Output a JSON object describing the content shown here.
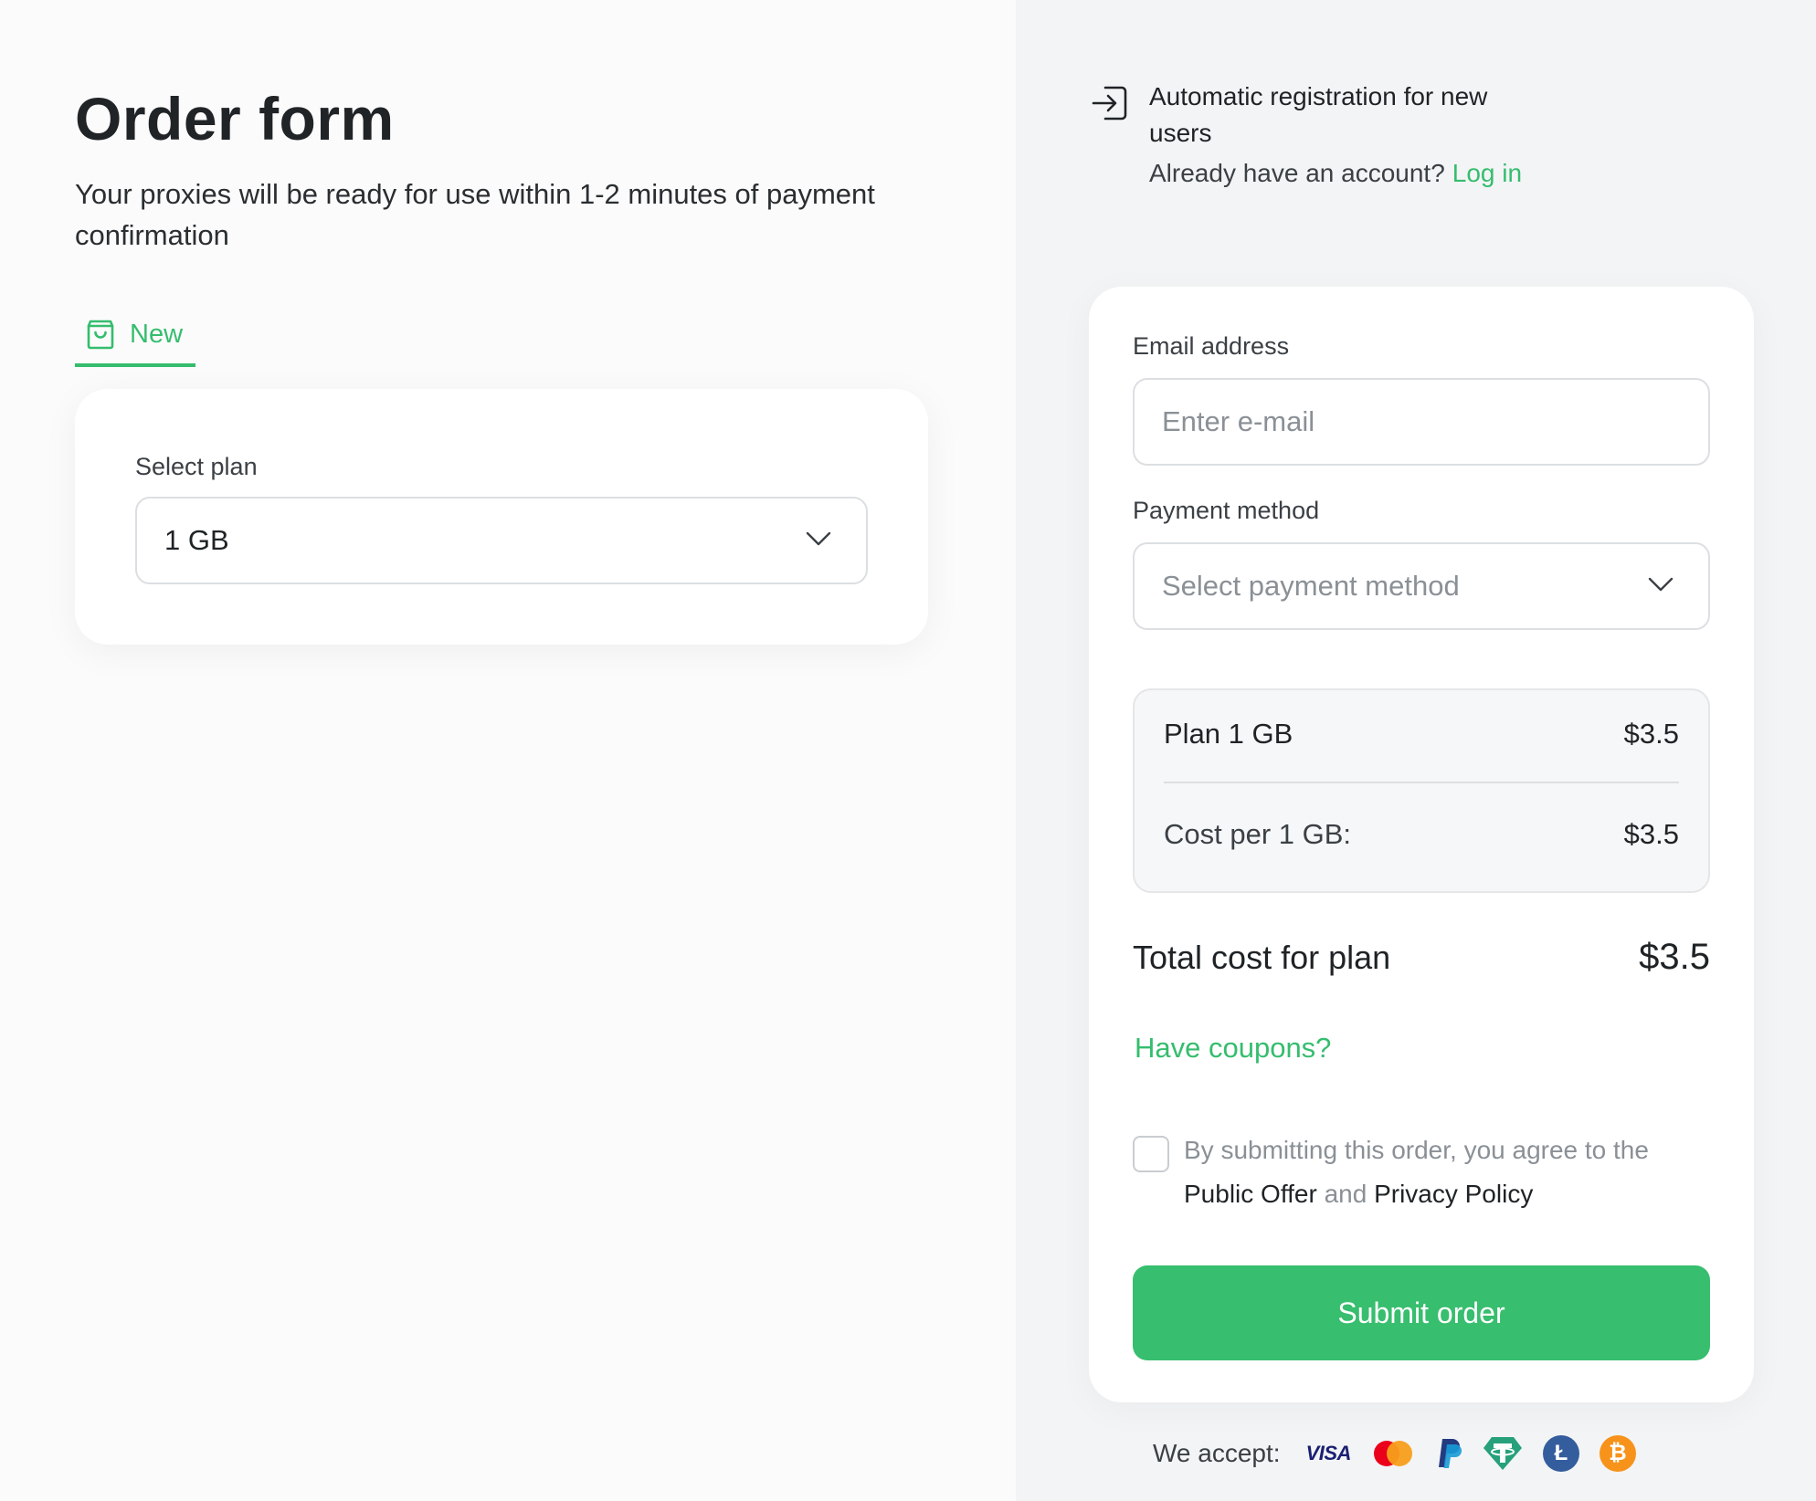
{
  "left": {
    "title": "Order form",
    "subtitle": "Your proxies will be ready for use within 1-2 minutes of payment confirmation",
    "tab": {
      "icon": "shopping-bag-icon",
      "label": "New"
    },
    "plan": {
      "label": "Select plan",
      "selected": "1 GB"
    }
  },
  "right": {
    "registration": {
      "icon": "sign-in-icon",
      "text": "Automatic registration for new users",
      "account_prompt": "Already have an account?",
      "login_link": "Log in"
    },
    "form": {
      "email_label": "Email address",
      "email_placeholder": "Enter e-mail",
      "email_value": "",
      "payment_label": "Payment method",
      "payment_placeholder": "Select payment method"
    },
    "summary": {
      "plan_label": "Plan 1 GB",
      "plan_price": "$3.5",
      "cost_per_label": "Cost per 1 GB:",
      "cost_per_value": "$3.5"
    },
    "total": {
      "label": "Total cost for plan",
      "value": "$3.5"
    },
    "coupons_link": "Have coupons?",
    "terms": {
      "prefix": "By submitting this order, you agree to the",
      "public_offer": "Public Offer",
      "and": "and",
      "privacy_policy": "Privacy Policy",
      "checked": false
    },
    "submit_label": "Submit order",
    "accept": {
      "label": "We accept:",
      "methods": [
        {
          "name": "visa",
          "text": "VISA",
          "color": "#1a1f71"
        },
        {
          "name": "mastercard",
          "colors": [
            "#eb001b",
            "#f79e1b"
          ]
        },
        {
          "name": "paypal",
          "color": "#253b80"
        },
        {
          "name": "tether",
          "color": "#26a17b"
        },
        {
          "name": "litecoin",
          "text": "Ł",
          "color": "#345d9d"
        },
        {
          "name": "bitcoin",
          "text": "₿",
          "color": "#f7931a"
        }
      ]
    }
  },
  "colors": {
    "accent": "#35bd6e",
    "button": "#37be6e",
    "left_bg": "#fbfbfb",
    "right_bg": "#f3f4f5"
  }
}
